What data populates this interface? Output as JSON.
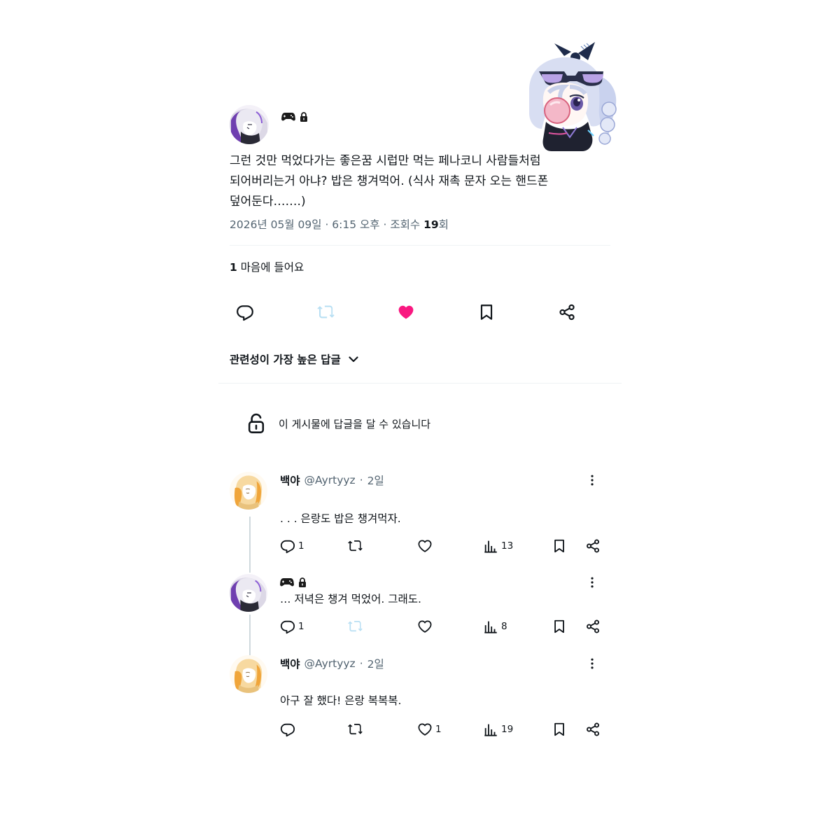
{
  "post": {
    "text_lines": [
      "그런 것만 먹었다가는 좋은꿈 시럽만 먹는 페나코니 사람들처럼",
      "되어버리는거 아냐? 밥은 챙겨먹어. (식사 재촉 문자 오는 핸드폰",
      "덮어둔다…….)"
    ],
    "date": "2026년 05월 09일 · 6:15 오후 · 조회수 ",
    "views": "19",
    "views_suffix": "회",
    "like_count": "1",
    "like_label": " 마음에 들어요",
    "liked": true,
    "retweet_enabled": false
  },
  "icons": {
    "badge_1": "gamepad-icon",
    "badge_2": "lock-icon",
    "reply": "reply-icon",
    "retweet": "retweet-icon",
    "like": "heart-icon",
    "bookmark": "bookmark-icon",
    "share": "share-icon",
    "views": "bar-chart-icon",
    "more": "more-vertical-icon",
    "reply_permission": "unlock-icon"
  },
  "sort_label": "관련성이 가장 높은 답글",
  "reply_permission": "이 게시물에 답글을 달 수 있습니다",
  "replies": [
    {
      "name": "백야",
      "handle": "@Ayrtyyz",
      "time": "2일",
      "text": ". . . 은랑도 밥은 챙겨먹자.",
      "reply_count": "1",
      "retweet_count": "",
      "like_count": "",
      "view_count": "13"
    },
    {
      "text": "… 저녁은 챙겨 먹었어. 그래도.",
      "reply_count": "1",
      "retweet_count": "",
      "like_count": "",
      "view_count": "8"
    },
    {
      "name": "백야",
      "handle": "@Ayrtyyz",
      "time": "2일",
      "text": "아구 잘 했다! 은랑 복복복.",
      "reply_count": "",
      "retweet_count": "",
      "like_count": "1",
      "view_count": "19"
    }
  ],
  "colors": {
    "text": "#0f1419",
    "secondary": "#536471",
    "divider": "#eff3f4",
    "thread_line": "#cfd9de",
    "like_active": "#f91880",
    "retweet_disabled": "#b8dff3"
  }
}
